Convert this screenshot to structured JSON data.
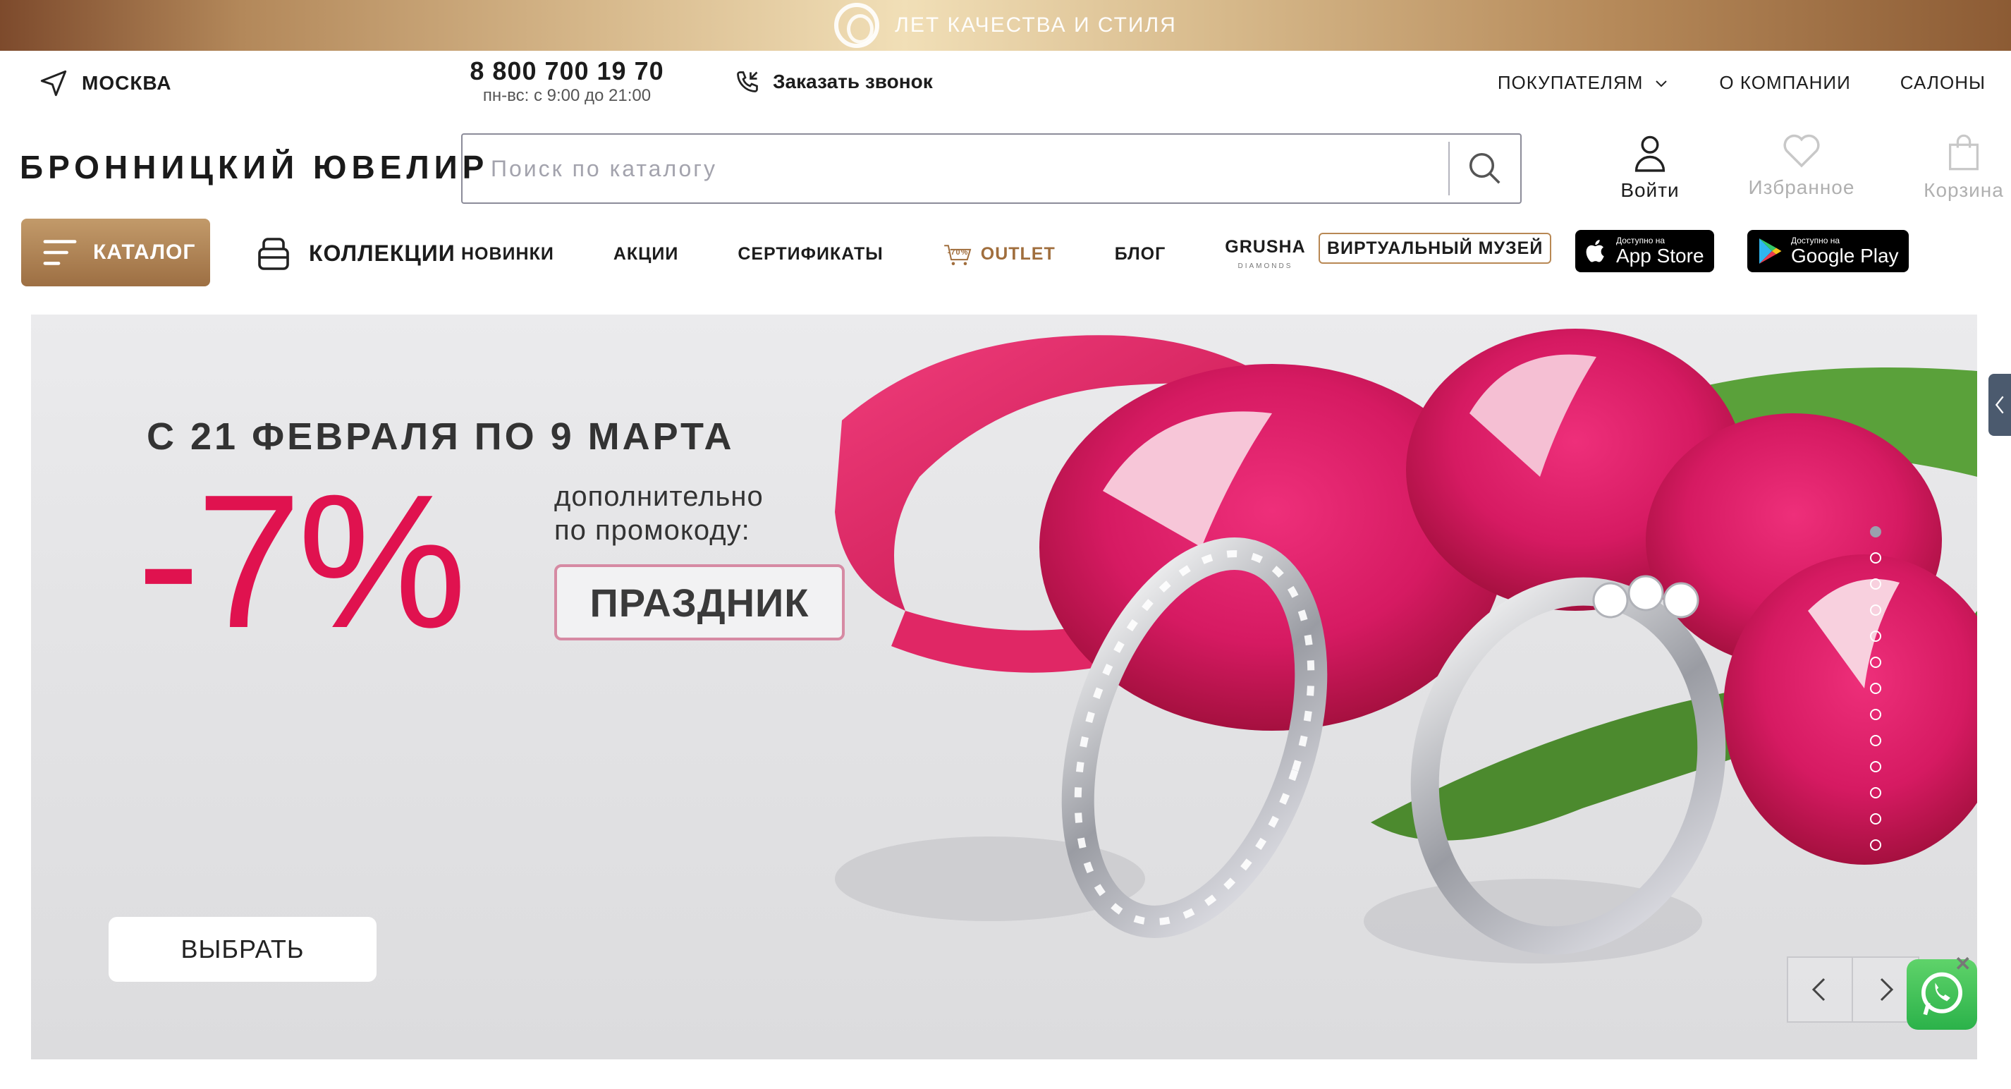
{
  "banner": {
    "text": "ЛЕТ КАЧЕСТВА И СТИЛЯ"
  },
  "header": {
    "city": "МОСКВА",
    "phone": "8 800 700 19 70",
    "hours": "пн-вс: с 9:00 до 21:00",
    "callback": "Заказать звонок",
    "top_nav": [
      {
        "label": "ПОКУПАТЕЛЯМ",
        "has_dropdown": true
      },
      {
        "label": "О КОМПАНИИ"
      },
      {
        "label": "САЛОНЫ"
      }
    ],
    "logo": "БРОННИЦКИЙ ЮВЕЛИР",
    "search_placeholder": "Поиск по каталогу",
    "user_actions": {
      "login": "Войти",
      "favorites": "Избранное",
      "cart": "Корзина"
    }
  },
  "nav": {
    "catalog": "КАТАЛОГ",
    "collections": "КОЛЛЕКЦИИ",
    "items": {
      "new": "НОВИНКИ",
      "sales": "АКЦИИ",
      "certificates": "СЕРТИФИКАТЫ",
      "outlet_badge": "-70%",
      "outlet": "OUTLET",
      "blog": "БЛОГ",
      "grusha": "GRUSHA",
      "grusha_sub": "DIAMONDS"
    },
    "museum": "ВИРТУАЛЬНЫЙ МУЗЕЙ",
    "appstore": {
      "small": "Доступно на",
      "big": "App Store"
    },
    "googleplay": {
      "small": "Доступно на",
      "big": "Google Play"
    }
  },
  "hero": {
    "date": "С 21 ФЕВРАЛЯ ПО 9 МАРТА",
    "discount": "-7%",
    "extra_line1": "дополнительно",
    "extra_line2": "по промокоду:",
    "promo_code": "ПРАЗДНИК",
    "cta": "ВЫБРАТЬ",
    "slides_total": 13,
    "active_slide": 1
  },
  "colors": {
    "accent_gold": "#a06e3d",
    "sale_pink": "#e0124f",
    "whatsapp": "#2bb24a"
  },
  "icons": [
    "location-arrow-icon",
    "phone-callback-icon",
    "chevron-down-icon",
    "search-icon",
    "user-icon",
    "heart-icon",
    "bag-icon",
    "menu-icon",
    "box-icon",
    "apple-icon",
    "google-play-icon",
    "chevron-left-icon",
    "chevron-right-icon",
    "whatsapp-icon",
    "close-icon"
  ]
}
